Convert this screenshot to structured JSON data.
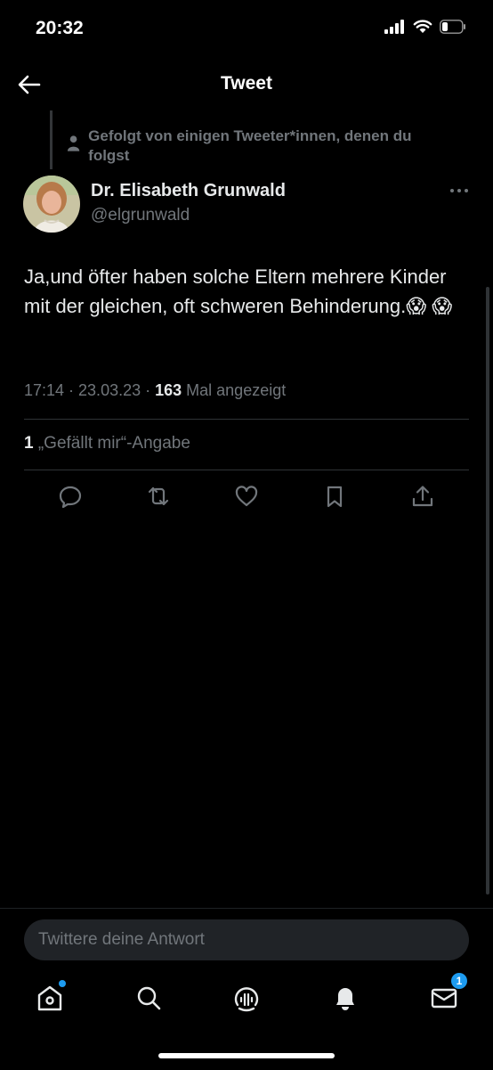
{
  "status_bar": {
    "time": "20:32",
    "battery_level": 0.25
  },
  "header": {
    "title": "Tweet"
  },
  "social_context": {
    "text": "Gefolgt von einigen Tweeter*innen, denen du folgst"
  },
  "tweet": {
    "author_name": "Dr. Elisabeth Grunwald",
    "author_handle": "@elgrunwald",
    "text": "Ja,und öfter haben solche Eltern mehrere Kinder mit der gleichen, oft schweren Behinderung.😱 😱",
    "time_date": "17:14 · 23.03.23 · ",
    "views_count": "163",
    "views_label": " Mal angezeigt",
    "likes_count": "1",
    "likes_label": " „Gefällt mir“-Angabe"
  },
  "reply": {
    "placeholder": "Twittere deine Antwort"
  },
  "tabbar": {
    "items": [
      "home-icon",
      "search-icon",
      "spaces-icon",
      "notifications-icon",
      "messages-icon"
    ],
    "messages_badge": "1"
  },
  "colors": {
    "background": "#000000",
    "text": "#e7e9ea",
    "secondary": "#71767b",
    "accent": "#1d9bf0"
  }
}
